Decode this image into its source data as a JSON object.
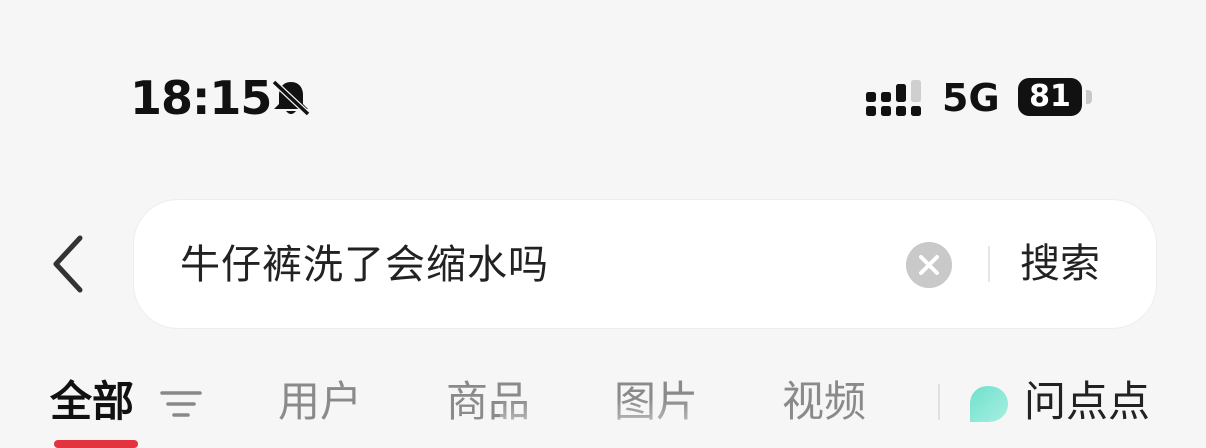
{
  "status_bar": {
    "time": "18:15",
    "network": "5G",
    "battery": "81"
  },
  "search": {
    "query": "牛仔裤洗了会缩水吗",
    "submit_label": "搜索"
  },
  "tabs": [
    {
      "label": "全部",
      "active": true
    },
    {
      "label": "用户"
    },
    {
      "label": "商品"
    },
    {
      "label": "图片"
    },
    {
      "label": "视频"
    }
  ],
  "assistant": {
    "label": "问点点"
  },
  "colors": {
    "accent": "#e2333f",
    "assistant_icon": "#7fe3d2"
  }
}
